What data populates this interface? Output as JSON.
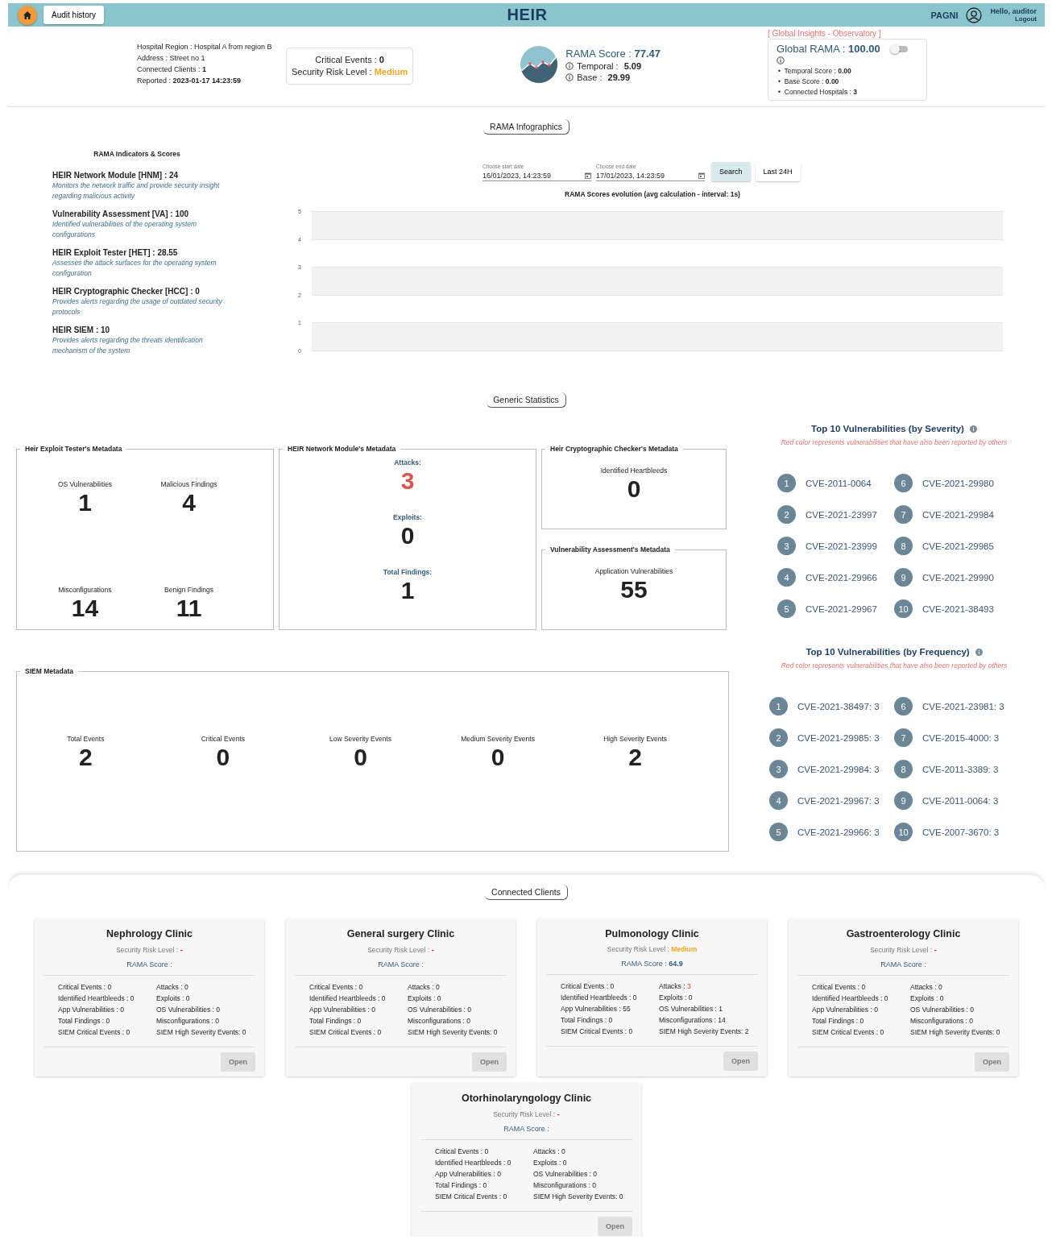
{
  "header": {
    "audit_button": "Audit history",
    "logo": "HEIR",
    "org": "PAGNI",
    "greeting": "Hello, auditor",
    "logout": "Logout"
  },
  "hospital": {
    "lines": [
      "Hospital Region : Hospital A from region B",
      "Address : Street no 1",
      "Connected Clients : **1**",
      "Reported : **2023-01-17 14:23:59**"
    ]
  },
  "events": {
    "critical": "Critical Events : **0**",
    "risk_label": "Security Risk Level : ",
    "risk_value": "Medium",
    "color": "#f5a623"
  },
  "rama": {
    "score_label": "RAMA Score : ",
    "score": "77.47",
    "temporal_label": "Temporal : ",
    "temporal": "5.09",
    "base_label": "Base : ",
    "base": "29.99"
  },
  "global": {
    "heading": "[ Global Insights - Observatory ]",
    "label": "Global RAMA : ",
    "value": "100.00",
    "on": false,
    "bullets": [
      "•  Temporal Score : **0.00**",
      "•  Base Score : **0.00**",
      "•  Connected Hospitals : **3**"
    ]
  },
  "infographics": {
    "tag": "RAMA Infographics",
    "indicators_title": "RAMA Indicators & Scores",
    "indicators": [
      {
        "name": "HEIR Network Module [HNM] : 24",
        "description": "Monitors the network traffic and provide security insight regarding malicious activity"
      },
      {
        "name": "Vulnerability Assessment [VA] : 100",
        "description": "Identified vulnerabilities of the operating system configurations"
      },
      {
        "name": "HEIR Exploit Tester [HET] : 28.55",
        "description": "Assesses the attack surfaces for the operating system configuration"
      },
      {
        "name": "HEIR Cryptographic Checker [HCC] : 0",
        "description": "Provides alerts regarding the usage of outdated security protocols"
      },
      {
        "name": "HEIR SIEM : 10",
        "description": "Provides alerts regarding the threats identification mechanism of the system"
      }
    ],
    "start_date": {
      "label": "Choose start date",
      "value": "16/01/2023, 14:23:59"
    },
    "end_date": {
      "label": "Choose end date",
      "value": "17/01/2023, 14:23:59"
    },
    "search_button": "Search",
    "last_button": "Last 24H",
    "chart": {
      "title": "RAMA Scores evolution (avg calculation - interval: 1s)",
      "y_ticks": [
        "5",
        "4",
        "3",
        "2",
        "1",
        "0"
      ]
    }
  },
  "statistics": {
    "tag": "Generic Statistics",
    "panels": [
      {
        "title": "Heir Exploit Tester's Metadata",
        "kind": "grid",
        "stats": [
          {
            "label": "OS Vulnerabilities",
            "value": "1",
            "alert": false
          },
          {
            "label": "Malicious Findings",
            "value": "4",
            "alert": false
          },
          {
            "label": "Misconfigurations",
            "value": "14",
            "alert": false
          },
          {
            "label": "Benign Findings",
            "value": "11",
            "alert": false
          }
        ]
      },
      {
        "title": "HEIR Network Module's Metadata",
        "kind": "stack",
        "stats": [
          {
            "label": "Attacks:",
            "value": "3",
            "alert": true
          },
          {
            "label": "Exploits:",
            "value": "0",
            "alert": false
          },
          {
            "label": "Total Findings:",
            "value": "1",
            "alert": false
          }
        ]
      },
      {
        "title": "Heir Cryptographic Checker's Metadata",
        "kind": "single",
        "stats": [
          {
            "label": "Identified Heartbleeds",
            "value": "0",
            "alert": false
          }
        ]
      },
      {
        "title": "Vulnerability Assessment's Metadata",
        "kind": "single",
        "stats": [
          {
            "label": "Application Vulnerabilities",
            "value": "55",
            "alert": false
          }
        ]
      },
      {
        "title": "SIEM Metadata",
        "kind": "row",
        "stats": [
          {
            "label": "Total Events",
            "value": "2",
            "alert": false
          },
          {
            "label": "Critical Events",
            "value": "0",
            "alert": false
          },
          {
            "label": "Low Severity Events",
            "value": "0",
            "alert": false
          },
          {
            "label": "Medium Severity Events",
            "value": "0",
            "alert": false
          },
          {
            "label": "High Severity Events",
            "value": "2",
            "alert": false
          }
        ]
      }
    ],
    "top_lists": [
      {
        "title": "Top 10 Vulnerabilities (by Severity)",
        "note": "Red color represents vulnerabilities that have also been reported by others",
        "items": [
          {
            "rank": "1",
            "text": "CVE-2011-0064"
          },
          {
            "rank": "2",
            "text": "CVE-2021-23997"
          },
          {
            "rank": "3",
            "text": "CVE-2021-23999"
          },
          {
            "rank": "4",
            "text": "CVE-2021-29966"
          },
          {
            "rank": "5",
            "text": "CVE-2021-29967"
          },
          {
            "rank": "6",
            "text": "CVE-2021-29980"
          },
          {
            "rank": "7",
            "text": "CVE-2021-29984"
          },
          {
            "rank": "8",
            "text": "CVE-2021-29985"
          },
          {
            "rank": "9",
            "text": "CVE-2021-29990"
          },
          {
            "rank": "10",
            "text": "CVE-2021-38493"
          }
        ]
      },
      {
        "title": "Top 10 Vulnerabilities (by Frequency)",
        "note": "Red color represents vulnerabilities that have also been reported by others",
        "items": [
          {
            "rank": "1",
            "text": "CVE-2021-38497: 3"
          },
          {
            "rank": "2",
            "text": "CVE-2021-29985: 3"
          },
          {
            "rank": "3",
            "text": "CVE-2021-29984: 3"
          },
          {
            "rank": "4",
            "text": "CVE-2021-29967: 3"
          },
          {
            "rank": "5",
            "text": "CVE-2021-29966: 3"
          },
          {
            "rank": "6",
            "text": "CVE-2021-23981: 3"
          },
          {
            "rank": "7",
            "text": "CVE-2015-4000: 3"
          },
          {
            "rank": "8",
            "text": "CVE-2011-3389: 3"
          },
          {
            "rank": "9",
            "text": "CVE-2011-0064: 3"
          },
          {
            "rank": "10",
            "text": "CVE-2007-3670: 3"
          }
        ]
      }
    ]
  },
  "clients": {
    "tag": "Connected Clients",
    "cards": [
      {
        "name": "Nephrology Clinic",
        "risk_label": "Security Risk Level : ",
        "risk_value": "-",
        "kind": "none",
        "score_label": "RAMA Score :",
        "button": "Open",
        "disabled": true,
        "stats": [
          {
            "label": "Critical Events : ",
            "value": "0",
            "alert": false
          },
          {
            "label": "Identified Heartbleeds : ",
            "value": "0",
            "alert": false
          },
          {
            "label": "App Vulnerabilities : ",
            "value": "0",
            "alert": false
          },
          {
            "label": "Total Findings : ",
            "value": "0",
            "alert": false
          },
          {
            "label": "SIEM Critical Events : ",
            "value": "0",
            "alert": false
          },
          {
            "label": "Attacks : ",
            "value": "0",
            "alert": false
          },
          {
            "label": "Exploits : ",
            "value": "0",
            "alert": false
          },
          {
            "label": "OS Vulnerabilities : ",
            "value": "0",
            "alert": false
          },
          {
            "label": "Misconfigurations : ",
            "value": "0",
            "alert": false
          },
          {
            "label": "SIEM High Severity Events: ",
            "value": "0",
            "alert": false
          }
        ]
      },
      {
        "name": "General surgery Clinic",
        "risk_label": "Security Risk Level : ",
        "risk_value": "-",
        "kind": "none",
        "score_label": "RAMA Score :",
        "button": "Open",
        "disabled": true,
        "stats": [
          {
            "label": "Critical Events : ",
            "value": "0",
            "alert": false
          },
          {
            "label": "Identified Heartbleeds : ",
            "value": "0",
            "alert": false
          },
          {
            "label": "App Vulnerabilities : ",
            "value": "0",
            "alert": false
          },
          {
            "label": "Total Findings : ",
            "value": "0",
            "alert": false
          },
          {
            "label": "SIEM Critical Events : ",
            "value": "0",
            "alert": false
          },
          {
            "label": "Attacks : ",
            "value": "0",
            "alert": false
          },
          {
            "label": "Exploits : ",
            "value": "0",
            "alert": false
          },
          {
            "label": "OS Vulnerabilities : ",
            "value": "0",
            "alert": false
          },
          {
            "label": "Misconfigurations : ",
            "value": "0",
            "alert": false
          },
          {
            "label": "SIEM High Severity Events: ",
            "value": "0",
            "alert": false
          }
        ]
      },
      {
        "name": "Pulmonology Clinic",
        "risk_label": "Security Risk Level : ",
        "risk_value": "Medium",
        "kind": "medium",
        "score_label": "RAMA Score :",
        "score": "64.9",
        "button": "Open",
        "disabled": true,
        "stats": [
          {
            "label": "Critical Events : ",
            "value": "0",
            "alert": false
          },
          {
            "label": "Identified Heartbleeds : ",
            "value": "0",
            "alert": false
          },
          {
            "label": "App Vulnerabilities : ",
            "value": "55",
            "alert": false
          },
          {
            "label": "Total Findings : ",
            "value": "0",
            "alert": false
          },
          {
            "label": "SIEM Critical Events : ",
            "value": "0",
            "alert": false
          },
          {
            "label": "Attacks : ",
            "value": "3",
            "alert": true
          },
          {
            "label": "Exploits : ",
            "value": "0",
            "alert": false
          },
          {
            "label": "OS Vulnerabilities : ",
            "value": "1",
            "alert": false
          },
          {
            "label": "Misconfigurations : ",
            "value": "14",
            "alert": false
          },
          {
            "label": "SIEM High Severity Events: ",
            "value": "2",
            "alert": false
          }
        ]
      },
      {
        "name": "Gastroenterology Clinic",
        "risk_label": "Security Risk Level : ",
        "risk_value": "-",
        "kind": "none",
        "score_label": "RAMA Score :",
        "button": "Open",
        "disabled": true,
        "stats": [
          {
            "label": "Critical Events : ",
            "value": "0",
            "alert": false
          },
          {
            "label": "Identified Heartbleeds : ",
            "value": "0",
            "alert": false
          },
          {
            "label": "App Vulnerabilities : ",
            "value": "0",
            "alert": false
          },
          {
            "label": "Total Findings : ",
            "value": "0",
            "alert": false
          },
          {
            "label": "SIEM Critical Events : ",
            "value": "0",
            "alert": false
          },
          {
            "label": "Attacks : ",
            "value": "0",
            "alert": false
          },
          {
            "label": "Exploits : ",
            "value": "0",
            "alert": false
          },
          {
            "label": "OS Vulnerabilities : ",
            "value": "0",
            "alert": false
          },
          {
            "label": "Misconfigurations : ",
            "value": "0",
            "alert": false
          },
          {
            "label": "SIEM High Severity Events: ",
            "value": "0",
            "alert": false
          }
        ]
      },
      {
        "name": "Otorhinolaryngology Clinic",
        "risk_label": "Security Risk Level : ",
        "risk_value": "-",
        "kind": "none",
        "score_label": "RAMA Score :",
        "button": "Open",
        "disabled": true,
        "stats": [
          {
            "label": "Critical Events : ",
            "value": "0",
            "alert": false
          },
          {
            "label": "Identified Heartbleeds : ",
            "value": "0",
            "alert": false
          },
          {
            "label": "App Vulnerabilities : ",
            "value": "0",
            "alert": false
          },
          {
            "label": "Total Findings : ",
            "value": "0",
            "alert": false
          },
          {
            "label": "SIEM Critical Events : ",
            "value": "0",
            "alert": false
          },
          {
            "label": "Attacks : ",
            "value": "0",
            "alert": false
          },
          {
            "label": "Exploits : ",
            "value": "0",
            "alert": false
          },
          {
            "label": "OS Vulnerabilities : ",
            "value": "0",
            "alert": false
          },
          {
            "label": "Misconfigurations : ",
            "value": "0",
            "alert": false
          },
          {
            "label": "SIEM High Severity Events: ",
            "value": "0",
            "alert": false
          }
        ]
      }
    ]
  }
}
